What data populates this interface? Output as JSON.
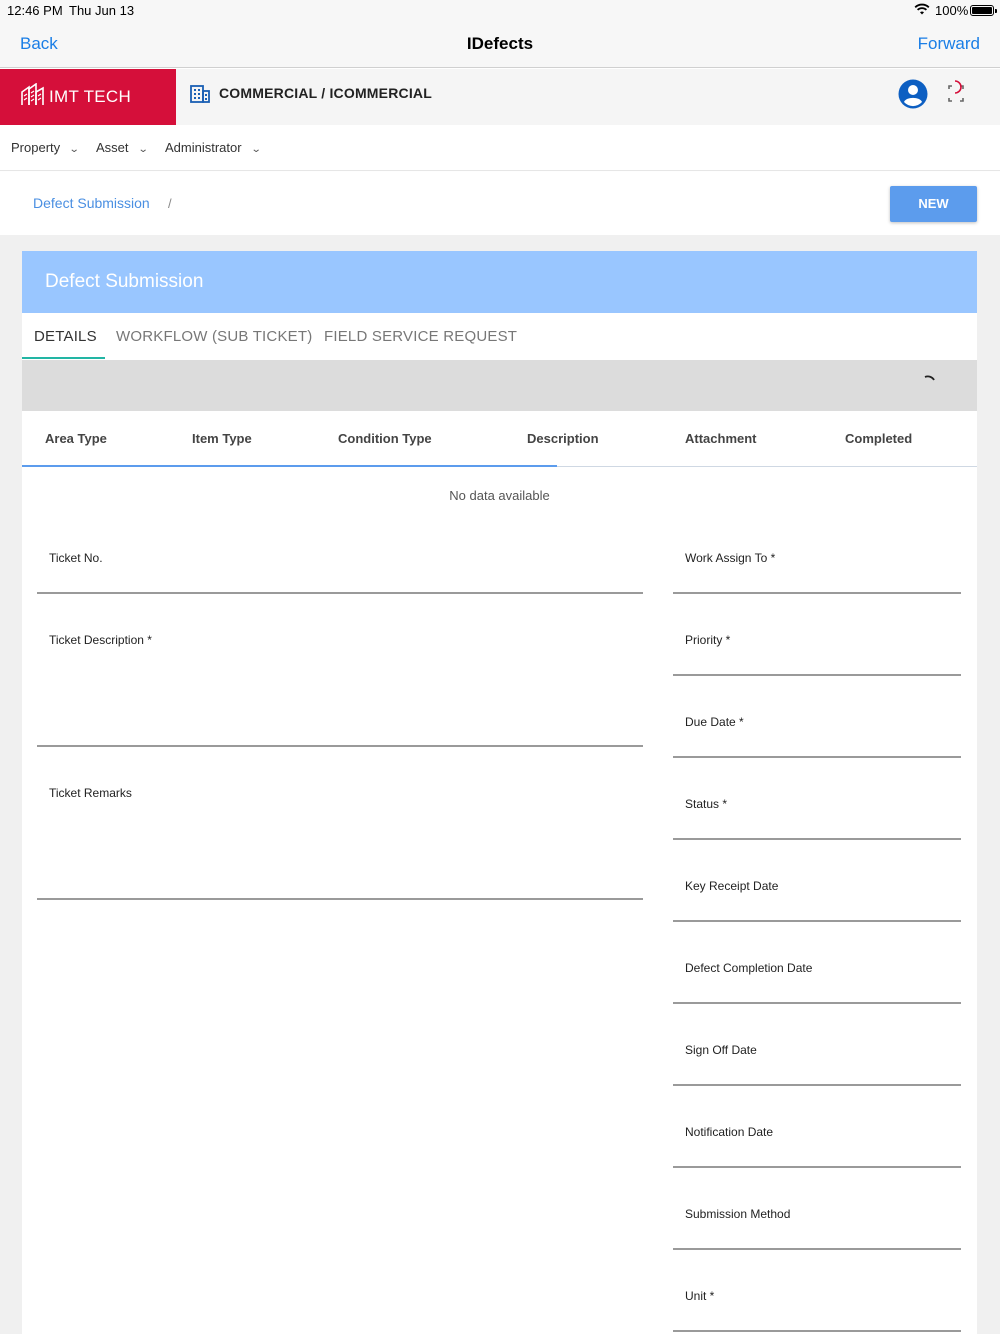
{
  "status_bar": {
    "time": "12:46 PM",
    "date": "Thu Jun 13",
    "battery": "100%"
  },
  "nav": {
    "back": "Back",
    "title": "IDefects",
    "forward": "Forward"
  },
  "header": {
    "logo_text": "IMT TECH",
    "organization": "COMMERCIAL / ICOMMERCIAL",
    "brand_color": "#d50f3a"
  },
  "menu": {
    "items": [
      "Property",
      "Asset",
      "Administrator"
    ]
  },
  "breadcrumb": {
    "current": "Defect Submission",
    "separator": "/"
  },
  "actions": {
    "new_label": "NEW"
  },
  "card": {
    "title": "Defect Submission",
    "tabs": [
      "DETAILS",
      "WORKFLOW (SUB TICKET)",
      "FIELD SERVICE REQUEST"
    ],
    "active_tab": "DETAILS"
  },
  "table": {
    "columns": [
      "Area Type",
      "Item Type",
      "Condition Type",
      "Description",
      "Attachment",
      "Completed"
    ],
    "empty_text": "No data available"
  },
  "form": {
    "left": [
      "Ticket No.",
      "Ticket Description *",
      "Ticket Remarks"
    ],
    "right": [
      "Work Assign To *",
      "Priority *",
      "Due Date *",
      "Status *",
      "Key Receipt Date",
      "Defect Completion Date",
      "Sign Off Date",
      "Notification Date",
      "Submission Method",
      "Unit *"
    ]
  }
}
